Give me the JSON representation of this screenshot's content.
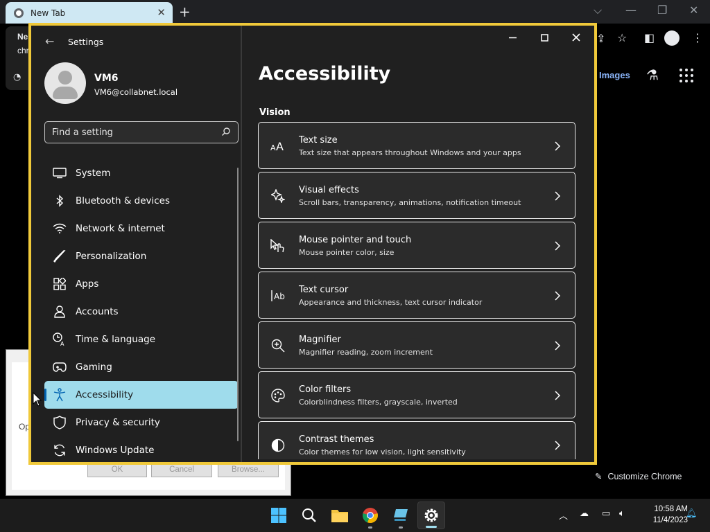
{
  "chrome": {
    "tab_title": "New Tab",
    "new_tab": "+",
    "images_link": "Images",
    "customize_label": "Customize Chrome",
    "bg_text_1": "Ne",
    "bg_text_2": "chr"
  },
  "run_dialog": {
    "ok": "OK",
    "cancel": "Cancel",
    "browse": "Browse...",
    "op_label": "Op"
  },
  "settings": {
    "app_title": "Settings",
    "user": {
      "name": "VM6",
      "email": "VM6@collabnet.local"
    },
    "search": {
      "placeholder": "Find a setting"
    },
    "nav": [
      {
        "label": "System",
        "icon": "monitor-icon"
      },
      {
        "label": "Bluetooth & devices",
        "icon": "bluetooth-icon"
      },
      {
        "label": "Network & internet",
        "icon": "wifi-icon"
      },
      {
        "label": "Personalization",
        "icon": "brush-icon"
      },
      {
        "label": "Apps",
        "icon": "apps-grid-icon"
      },
      {
        "label": "Accounts",
        "icon": "person-icon"
      },
      {
        "label": "Time & language",
        "icon": "clock-language-icon"
      },
      {
        "label": "Gaming",
        "icon": "gamepad-icon"
      },
      {
        "label": "Accessibility",
        "icon": "accessibility-icon",
        "active": true
      },
      {
        "label": "Privacy & security",
        "icon": "shield-icon"
      },
      {
        "label": "Windows Update",
        "icon": "update-icon"
      }
    ],
    "page_title": "Accessibility",
    "section_title": "Vision",
    "cards": [
      {
        "title": "Text size",
        "desc": "Text size that appears throughout Windows and your apps",
        "icon": "text-size-icon"
      },
      {
        "title": "Visual effects",
        "desc": "Scroll bars, transparency, animations, notification timeout",
        "icon": "sparkle-icon"
      },
      {
        "title": "Mouse pointer and touch",
        "desc": "Mouse pointer color, size",
        "icon": "pointer-touch-icon"
      },
      {
        "title": "Text cursor",
        "desc": "Appearance and thickness, text cursor indicator",
        "icon": "text-cursor-icon"
      },
      {
        "title": "Magnifier",
        "desc": "Magnifier reading, zoom increment",
        "icon": "magnifier-icon"
      },
      {
        "title": "Color filters",
        "desc": "Colorblindness filters, grayscale, inverted",
        "icon": "palette-icon"
      },
      {
        "title": "Contrast themes",
        "desc": "Color themes for low vision, light sensitivity",
        "icon": "contrast-icon"
      }
    ]
  },
  "taskbar": {
    "time": "10:58 AM",
    "date": "11/4/2023"
  },
  "colors": {
    "accent_selection": "#9fdcec",
    "window_border": "#f0c93a",
    "background": "#202020"
  }
}
